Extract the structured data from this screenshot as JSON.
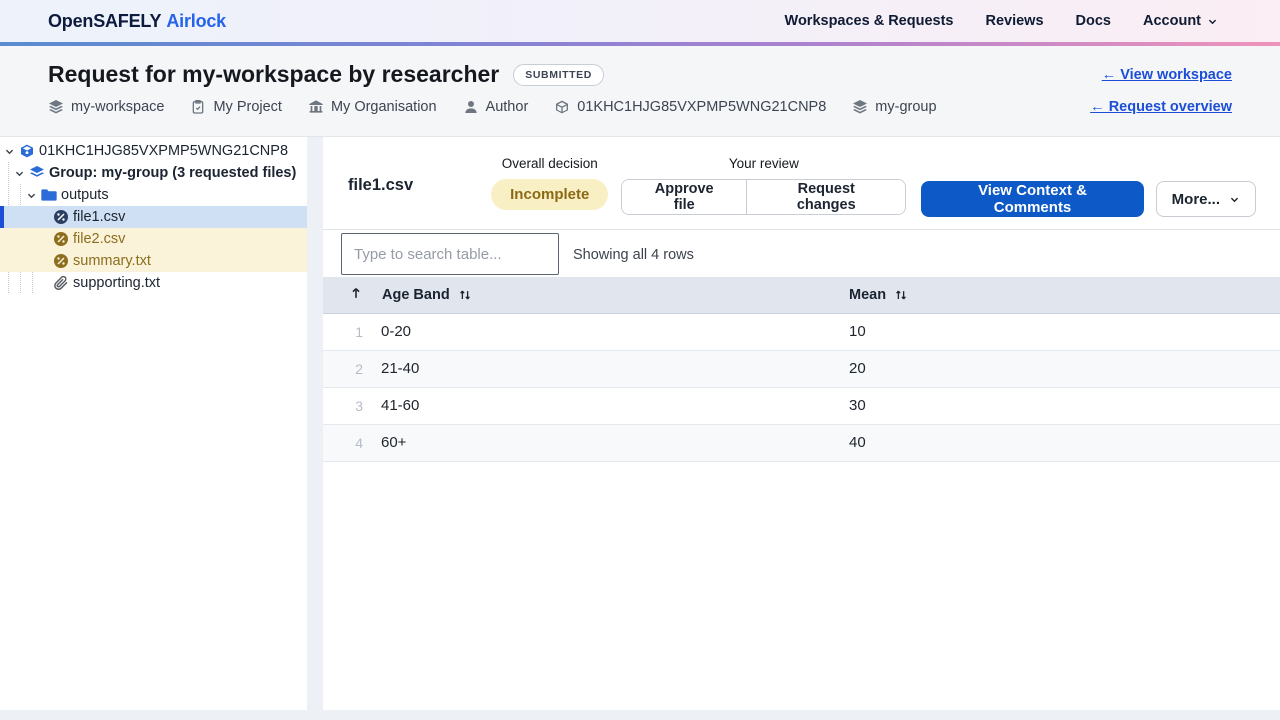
{
  "nav": {
    "brand_primary": "OpenSAFELY",
    "brand_secondary": "Airlock",
    "items": [
      {
        "label": "Workspaces & Requests"
      },
      {
        "label": "Reviews"
      },
      {
        "label": "Docs"
      },
      {
        "label": "Account"
      }
    ]
  },
  "header": {
    "title": "Request for my-workspace by researcher",
    "status_badge": "SUBMITTED",
    "link_workspace": "← View workspace",
    "link_overview": "← Request overview",
    "meta": [
      {
        "icon": "layers-icon",
        "label": "my-workspace"
      },
      {
        "icon": "clipboard-icon",
        "label": "My Project"
      },
      {
        "icon": "bank-icon",
        "label": "My Organisation"
      },
      {
        "icon": "person-icon",
        "label": "Author"
      },
      {
        "icon": "cube-icon",
        "label": "01KHC1HJG85VXPMP5WNG21CNP8"
      },
      {
        "icon": "layers-icon",
        "label": "my-group"
      }
    ]
  },
  "sidebar": {
    "tree": [
      {
        "label": "01KHC1HJG85VXPMP5WNG21CNP8",
        "depth": 0,
        "icon": "cube-icon"
      },
      {
        "label": "Group: my-group (3 requested files)",
        "depth": 1,
        "icon": "layers-icon"
      },
      {
        "label": "outputs",
        "depth": 2,
        "icon": "folder-icon"
      },
      {
        "label": "file1.csv",
        "depth": 3,
        "icon": "percent-circle-icon",
        "state": "selected"
      },
      {
        "label": "file2.csv",
        "depth": 3,
        "icon": "percent-circle-icon",
        "state": "pending"
      },
      {
        "label": "summary.txt",
        "depth": 3,
        "icon": "percent-circle-icon",
        "state": "pending"
      },
      {
        "label": "supporting.txt",
        "depth": 3,
        "icon": "paperclip-icon",
        "state": "none"
      }
    ]
  },
  "file_view": {
    "title": "file1.csv",
    "overall_decision_label": "Overall decision",
    "decision": "Incomplete",
    "review_label": "Your review",
    "approve_label": "Approve file",
    "request_changes_label": "Request changes",
    "context_label": "View Context & Comments",
    "more_label": "More..."
  },
  "search": {
    "placeholder": "Type to search table...",
    "status": "Showing all 4 rows"
  },
  "table": {
    "columns": [
      "Age Band",
      "Mean"
    ],
    "rows": [
      {
        "n": "1",
        "band": "0-20",
        "mean": "10"
      },
      {
        "n": "2",
        "band": "21-40",
        "mean": "20"
      },
      {
        "n": "3",
        "band": "41-60",
        "mean": "30"
      },
      {
        "n": "4",
        "band": "60+",
        "mean": "40"
      }
    ]
  },
  "colors": {
    "brand_blue": "#2563eb",
    "primary_button": "#0e59c8",
    "link": "#1c4fd6",
    "decision_badge_bg": "#f9efc4",
    "decision_badge_text": "#8a6a15",
    "selected_file_bg": "#cfe0f4",
    "selected_file_stripe": "#1d4ed8",
    "pending_file_bg": "#faf3da",
    "pending_file_text": "#8d6e1e",
    "nav_gradient": [
      "#598ccf",
      "#7f83d4",
      "#a981cf",
      "#ef93ba"
    ],
    "table_header_bg": "#e0e5ee"
  }
}
